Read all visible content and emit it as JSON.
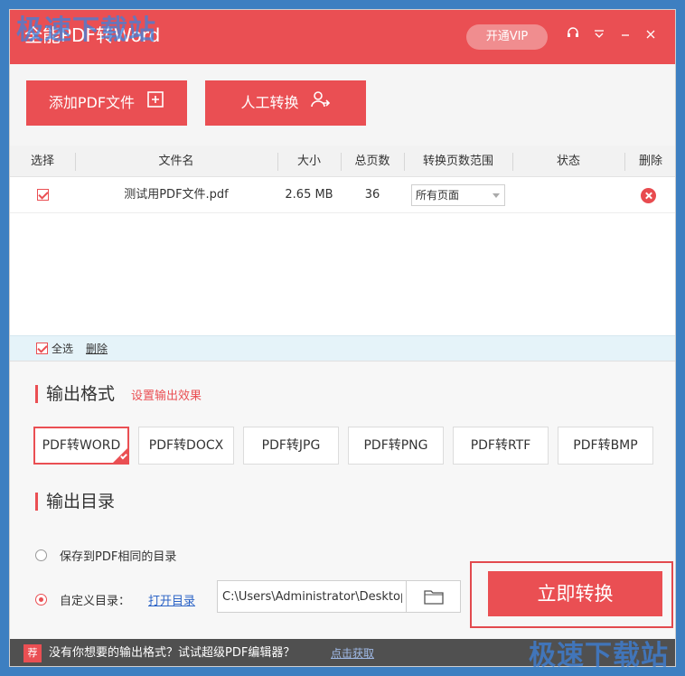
{
  "window": {
    "title": "全能PDF转Word",
    "vip_label": "开通VIP"
  },
  "toolbar": {
    "add_label": "添加PDF文件",
    "manual_label": "人工转换"
  },
  "table": {
    "headers": {
      "select": "选择",
      "filename": "文件名",
      "size": "大小",
      "pages": "总页数",
      "range": "转换页数范围",
      "status": "状态",
      "delete": "删除"
    },
    "rows": [
      {
        "filename": "测试用PDF文件.pdf",
        "size": "2.65 MB",
        "pages": "36",
        "range": "所有页面",
        "status": ""
      }
    ]
  },
  "select_bar": {
    "select_all": "全选",
    "delete": "删除"
  },
  "output_format": {
    "title": "输出格式",
    "settings_link": "设置输出效果",
    "options": [
      "PDF转WORD",
      "PDF转DOCX",
      "PDF转JPG",
      "PDF转PNG",
      "PDF转RTF",
      "PDF转BMP"
    ],
    "selected": "PDF转WORD"
  },
  "output_dir": {
    "title": "输出目录",
    "option_same": "保存到PDF相同的目录",
    "option_custom": "自定义目录：",
    "open_dir": "打开目录",
    "path": "C:\\Users\\Administrator\\Desktop"
  },
  "convert_label": "立即转换",
  "promo": {
    "badge": "荐",
    "text": "没有你想要的输出格式？试试超级PDF编辑器？",
    "link": "点击获取"
  },
  "watermark": "极速下载站",
  "colors": {
    "accent": "#ea4f53",
    "desktop": "#3d7fc1"
  }
}
